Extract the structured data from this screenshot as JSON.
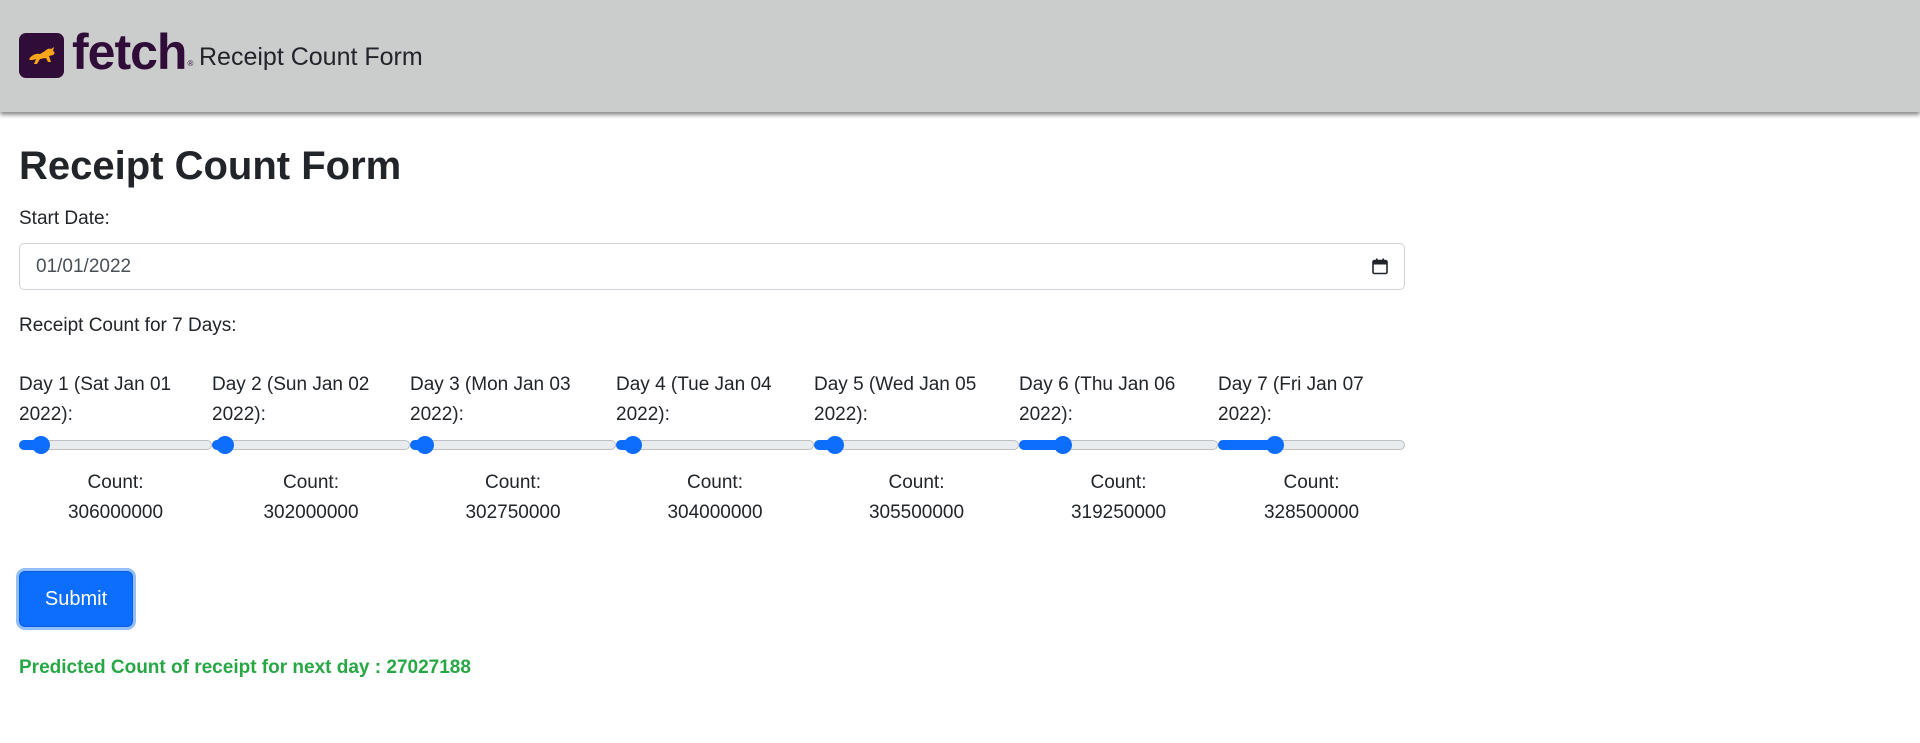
{
  "header": {
    "logo_text": "fetch",
    "logo_mark": "®",
    "logo_icon": "running-dog-icon",
    "title": "Receipt Count Form"
  },
  "form": {
    "title": "Receipt Count Form",
    "start_date_label": "Start Date:",
    "start_date_value": "01/01/2022",
    "date_icon": "calendar-icon",
    "receipt_count_label": "Receipt Count for 7 Days:",
    "count_label": "Count:",
    "days": [
      {
        "label": "Day 1 (Sat Jan 01 2022):",
        "count": "306000000",
        "slider_fraction": 0.11
      },
      {
        "label": "Day 2 (Sun Jan 02 2022):",
        "count": "302000000",
        "slider_fraction": 0.06
      },
      {
        "label": "Day 3 (Mon Jan 03 2022):",
        "count": "302750000",
        "slider_fraction": 0.07
      },
      {
        "label": "Day 4 (Tue Jan 04 2022):",
        "count": "304000000",
        "slider_fraction": 0.08
      },
      {
        "label": "Day 5 (Wed Jan 05 2022):",
        "count": "305500000",
        "slider_fraction": 0.1
      },
      {
        "label": "Day 6 (Thu Jan 06 2022):",
        "count": "319250000",
        "slider_fraction": 0.22
      },
      {
        "label": "Day 7 (Fri Jan 07 2022):",
        "count": "328500000",
        "slider_fraction": 0.3
      }
    ],
    "submit_label": "Submit"
  },
  "result": {
    "prediction_text": "Predicted Count of receipt for next day : 27027188"
  },
  "colors": {
    "navbar_bg": "#cbcccc",
    "brand": "#300d38",
    "logo_dog": "#f8a51b",
    "primary": "#0d6efd",
    "success": "#28a745"
  }
}
